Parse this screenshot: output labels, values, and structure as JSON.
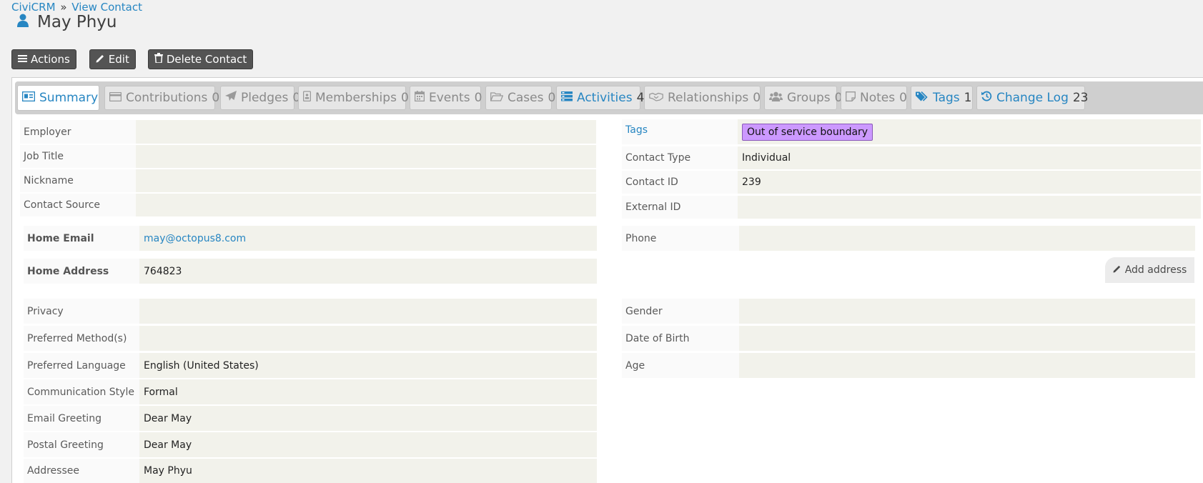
{
  "breadcrumb": {
    "root": "CiviCRM",
    "separator": "»",
    "current": "View Contact"
  },
  "contact": {
    "name": "May Phyu",
    "icon": "person-icon"
  },
  "actions": {
    "actions_label": "Actions",
    "edit_label": "Edit",
    "delete_label": "Delete Contact"
  },
  "tabs": [
    {
      "label": "Summary",
      "count": "",
      "icon": "id-card-icon",
      "state": "active"
    },
    {
      "label": "Contributions",
      "count": "0",
      "icon": "credit-card-icon",
      "state": "disabled"
    },
    {
      "label": "Pledges",
      "count": "0",
      "icon": "paper-plane-icon",
      "state": "disabled"
    },
    {
      "label": "Memberships",
      "count": "0",
      "icon": "id-badge-icon",
      "state": "disabled"
    },
    {
      "label": "Events",
      "count": "0",
      "icon": "calendar-icon",
      "state": "disabled"
    },
    {
      "label": "Cases",
      "count": "0",
      "icon": "folder-open-icon",
      "state": "disabled"
    },
    {
      "label": "Activities",
      "count": "4",
      "icon": "tasks-icon",
      "state": "link"
    },
    {
      "label": "Relationships",
      "count": "0",
      "icon": "handshake-icon",
      "state": "disabled"
    },
    {
      "label": "Groups",
      "count": "0",
      "icon": "users-icon",
      "state": "disabled"
    },
    {
      "label": "Notes",
      "count": "0",
      "icon": "sticky-note-icon",
      "state": "disabled"
    },
    {
      "label": "Tags",
      "count": "1",
      "icon": "tags-icon",
      "state": "link"
    },
    {
      "label": "Change Log",
      "count": "23",
      "icon": "history-icon",
      "state": "link"
    }
  ],
  "left_fields": {
    "employer": {
      "label": "Employer",
      "value": ""
    },
    "job_title": {
      "label": "Job Title",
      "value": ""
    },
    "nickname": {
      "label": "Nickname",
      "value": ""
    },
    "contact_source": {
      "label": "Contact Source",
      "value": ""
    },
    "home_email": {
      "label": "Home Email",
      "value": "may@octopus8.com"
    },
    "home_address": {
      "label": "Home Address",
      "value": "764823"
    },
    "privacy": {
      "label": "Privacy",
      "value": ""
    },
    "preferred_methods": {
      "label": "Preferred Method(s)",
      "value": ""
    },
    "preferred_language": {
      "label": "Preferred Language",
      "value": "English (United States)"
    },
    "communication_style": {
      "label": "Communication Style",
      "value": "Formal"
    },
    "email_greeting": {
      "label": "Email Greeting",
      "value": "Dear May"
    },
    "postal_greeting": {
      "label": "Postal Greeting",
      "value": "Dear May"
    },
    "addressee": {
      "label": "Addressee",
      "value": "May Phyu"
    }
  },
  "right_fields": {
    "tags": {
      "label": "Tags",
      "value": "Out of service boundary",
      "color": "#cc99ff"
    },
    "contact_type": {
      "label": "Contact Type",
      "value": "Individual"
    },
    "contact_id": {
      "label": "Contact ID",
      "value": "239"
    },
    "external_id": {
      "label": "External ID",
      "value": ""
    },
    "phone": {
      "label": "Phone",
      "value": ""
    },
    "add_address": {
      "label": "Add address"
    },
    "gender": {
      "label": "Gender",
      "value": ""
    },
    "date_of_birth": {
      "label": "Date of Birth",
      "value": ""
    },
    "age": {
      "label": "Age",
      "value": ""
    }
  },
  "colors": {
    "link": "#2786c2",
    "button_bg": "#545454",
    "value_bg": "#f2f2eb",
    "tag_bg": "#cc99ff"
  }
}
